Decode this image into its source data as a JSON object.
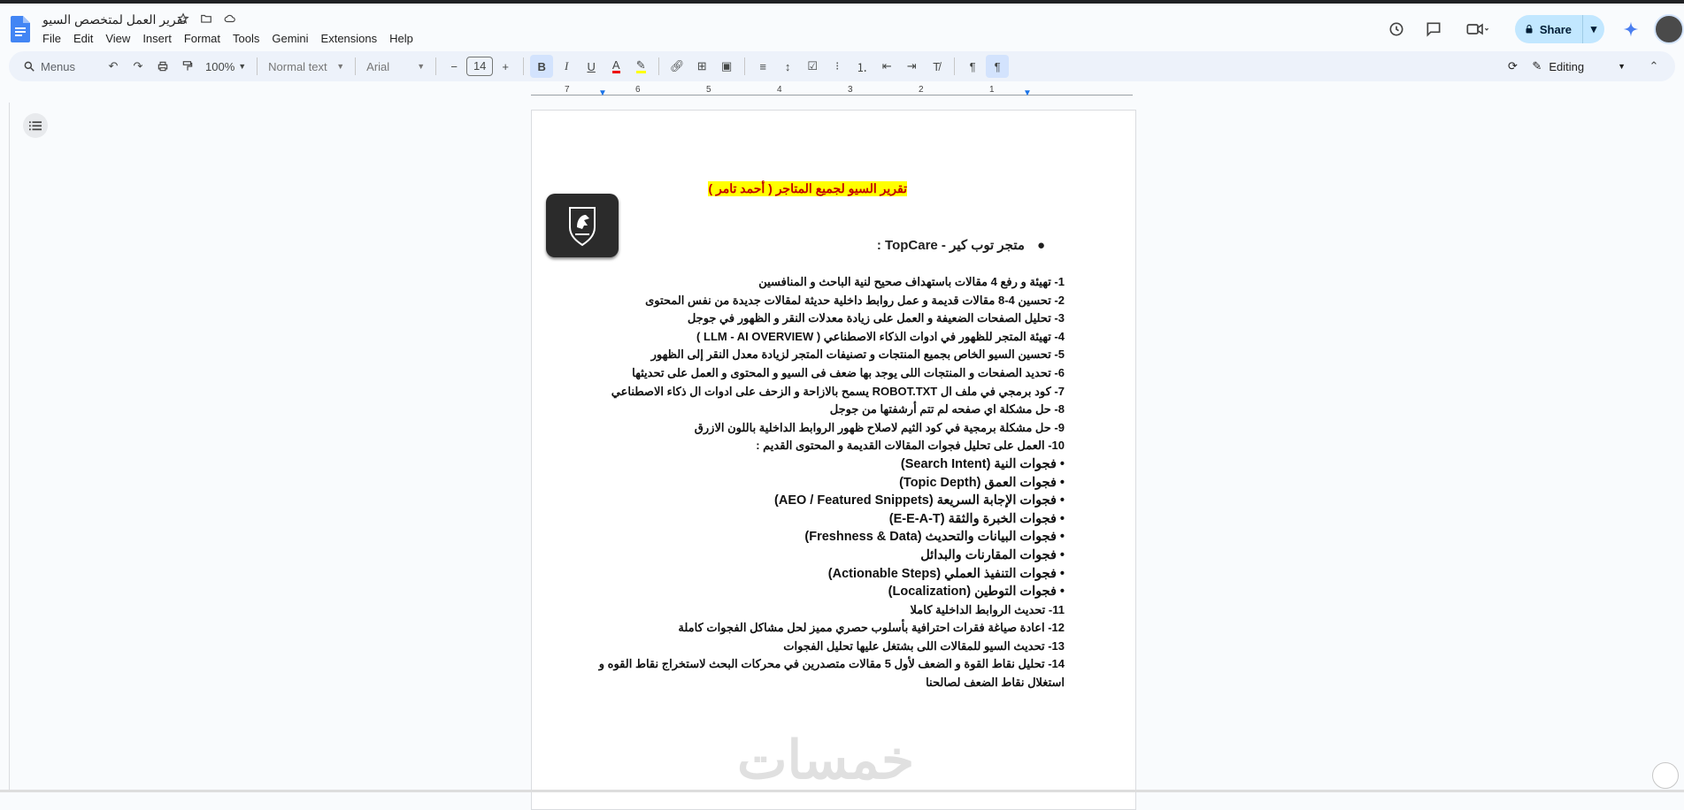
{
  "window": {
    "doc_title": "تقرير العمل لمتخصص السيو",
    "menu": [
      "File",
      "Edit",
      "View",
      "Insert",
      "Format",
      "Tools",
      "Gemini",
      "Extensions",
      "Help"
    ]
  },
  "header_actions": {
    "share_label": "Share"
  },
  "toolbar": {
    "search_label": "Menus",
    "zoom": "100%",
    "style": "Normal text",
    "font": "Arial",
    "font_size": "14",
    "mode": "Editing"
  },
  "ruler": {
    "numbers": [
      "7",
      "6",
      "5",
      "4",
      "3",
      "2",
      "1"
    ]
  },
  "document": {
    "heading": "تقرير السيو لجميع المتاجر ( أحمد تامر )",
    "store_title": "متجر توب كير - TopCare :",
    "lines": [
      "1- تهيئة و رفع 4 مقالات باستهداف صحيح لنية الباحث و المنافسين",
      "2- تحسين 4-8 مقالات قديمة و عمل روابط داخلية حديثة لمقالات جديدة من نفس المحتوى",
      "3- تحليل الصفحات الضعيفة و العمل على زيادة معدلات النقر و الظهور في جوجل",
      "4- تهيئة المتجر للظهور في ادوات الذكاء الاصطناعي ( LLM - AI OVERVIEW )",
      "5- تحسين السيو الخاص بجميع المنتجات و تصنيفات المتجر لزيادة معدل النقر إلى الظهور",
      "6- تحديد الصفحات و المنتجات اللى يوجد بها ضعف فى السيو و المحتوى و العمل على تحديثها",
      "7- كود برمجي في ملف ال ROBOT.TXT يسمح بالازاحة و الزحف على ادوات ال ذكاء الاصطناعي",
      "8- حل مشكلة اي صفحه لم تتم أرشفتها من جوجل",
      "9- حل مشكلة برمجية في كود الثيم لاصلاح ظهور الروابط الداخلية باللون الازرق",
      "10- العمل على تحليل فجوات المقالات القديمة و المحتوى القديم :",
      "• فجوات النية (Search Intent)",
      "• فجوات العمق (Topic Depth)",
      "• فجوات الإجابة السريعة (AEO / Featured Snippets)",
      "• فجوات الخبرة والثقة (E-E-A-T)",
      "• فجوات البيانات والتحديث (Freshness & Data)",
      "• فجوات المقارنات والبدائل",
      "• فجوات التنفيذ العملي (Actionable Steps)",
      "• فجوات التوطين (Localization)",
      "11- تحديث الروابط الداخلية كاملا",
      "12- اعادة صياغة فقرات احترافية بأسلوب حصري مميز لحل مشاكل الفجوات كاملة",
      "13- تحديث السيو للمقالات اللى بشتغل عليها تحليل الفجوات",
      "14- تحليل نقاط القوة و الضعف لأول 5 مقالات متصدرين في محركات البحث لاستخراج نقاط القوه و",
      "استغلال نقاط الضعف لصالحنا"
    ],
    "watermark": "خمسات"
  }
}
